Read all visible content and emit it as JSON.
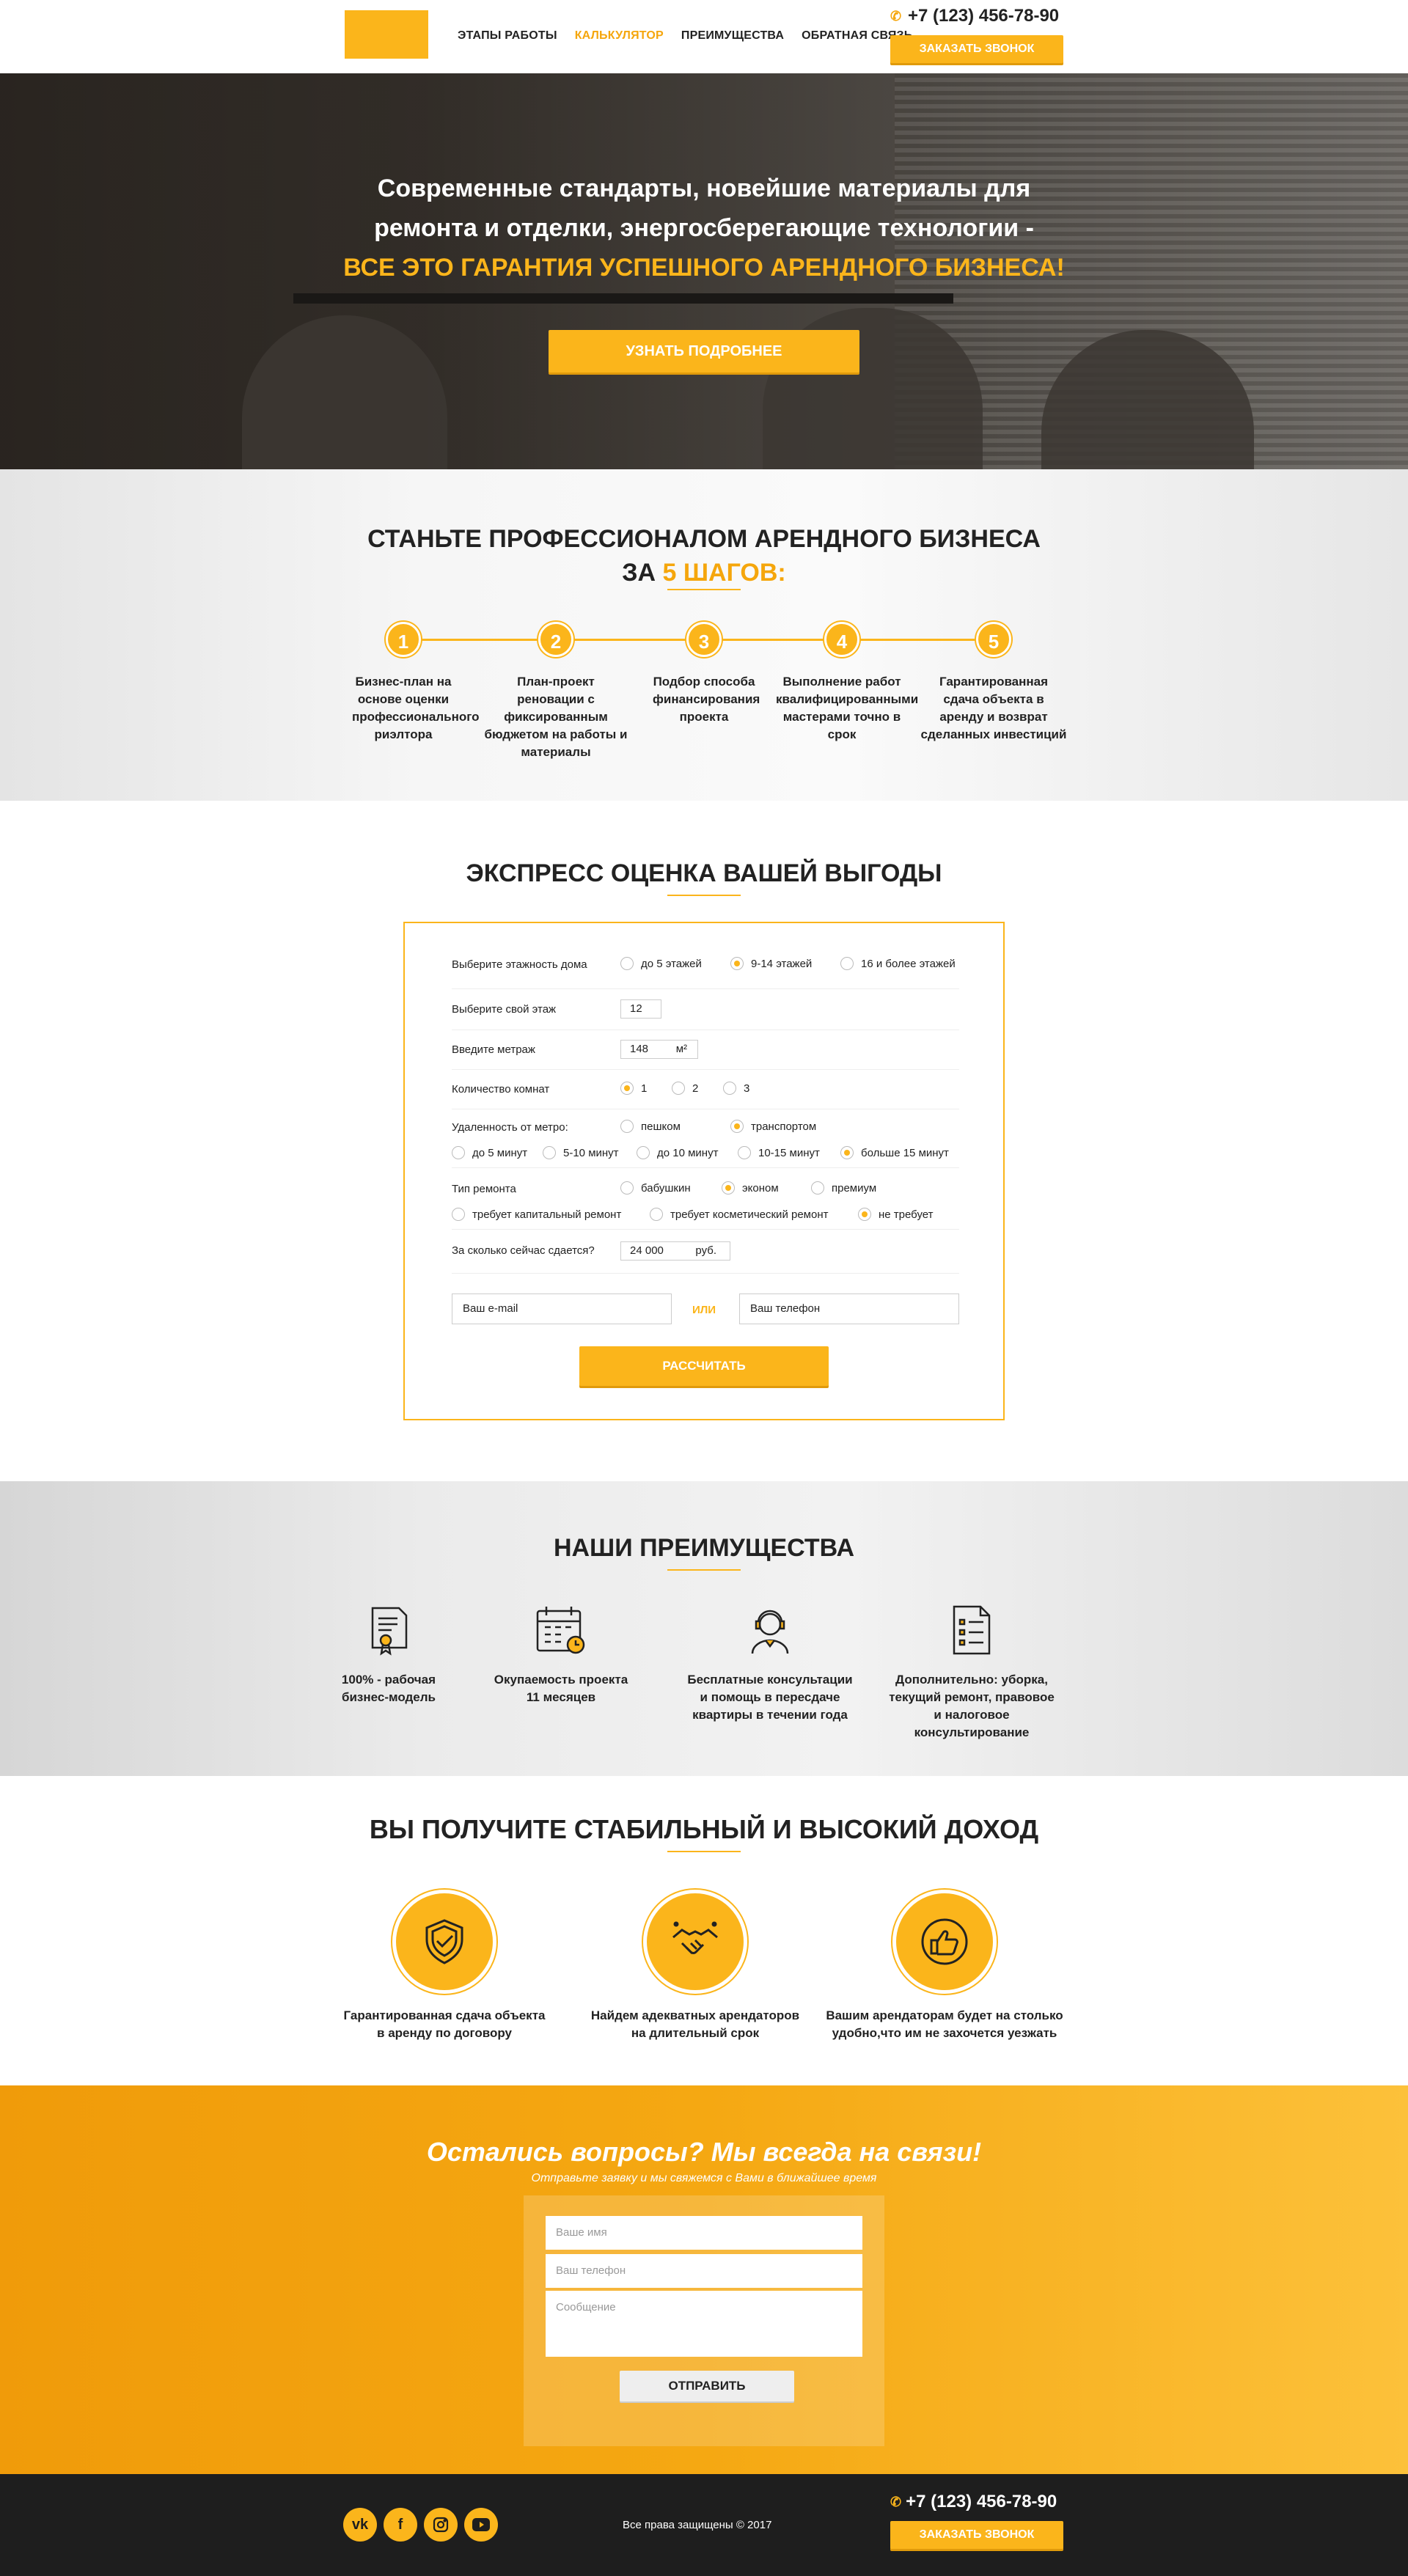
{
  "header": {
    "nav": [
      "ЭТАПЫ РАБОТЫ",
      "КАЛЬКУЛЯТОР",
      "ПРЕИМУЩЕСТВА",
      "ОБРАТНАЯ СВЯЗЬ"
    ],
    "active_nav_index": 1,
    "phone": "+7 (123) 456-78-90",
    "call_button": "ЗАКАЗАТЬ ЗВОНОК"
  },
  "hero": {
    "line1": "Современные стандарты, новейшие материалы для",
    "line2": "ремонта и отделки, энергосберегающие технологии -",
    "line3": "ВСЕ ЭТО ГАРАНТИЯ УСПЕШНОГО АРЕНДНОГО БИЗНЕСА!",
    "button": "УЗНАТЬ ПОДРОБНЕЕ"
  },
  "steps": {
    "title_line1": "СТАНЬТЕ ПРОФЕССИОНАЛОМ АРЕНДНОГО БИЗНЕСА",
    "title_line2_a": "ЗА ",
    "title_line2_b": "5 ШАГОВ:",
    "items": [
      {
        "num": "1",
        "text": "Бизнес-план на основе оценки профессионального риэлтора"
      },
      {
        "num": "2",
        "text": "План-проект реновации с фиксированным бюджетом на работы и материалы"
      },
      {
        "num": "3",
        "text": "Подбор способа финансирования проекта"
      },
      {
        "num": "4",
        "text": "Выполнение работ квалифицированными мастерами точно в срок"
      },
      {
        "num": "5",
        "text": "Гарантированная сдача объекта в аренду и возврат сделанных инвестиций"
      }
    ]
  },
  "express": {
    "title": "ЭКСПРЕСС ОЦЕНКА ВАШЕЙ ВЫГОДЫ",
    "floors_label": "Выберите этажность дома",
    "floors_options": [
      "до 5 этажей",
      "9-14 этажей",
      "16 и более этажей"
    ],
    "floors_selected": 1,
    "floor_label": "Выберите свой этаж",
    "floor_value": "12",
    "area_label": "Введите метраж",
    "area_value": "148",
    "area_unit": "м²",
    "rooms_label": "Количество комнат",
    "rooms_options": [
      "1",
      "2",
      "3"
    ],
    "rooms_selected": 0,
    "metro_label": "Удаленность от метро:",
    "metro_mode_options": [
      "пешком",
      "транспортом"
    ],
    "metro_mode_selected": 1,
    "metro_time_options": [
      "до 5 минут",
      "5-10 минут",
      "до 10 минут",
      "10-15 минут",
      "больше 15 минут"
    ],
    "metro_time_selected": 4,
    "repair_label": "Тип ремонта",
    "repair_options": [
      "бабушкин",
      "эконом",
      "премиум"
    ],
    "repair_selected": 1,
    "repair_need_options": [
      "требует капитальный ремонт",
      "требует косметический ремонт",
      "не требует"
    ],
    "repair_need_selected": 2,
    "rent_label": "За сколько сейчас сдается?",
    "rent_value": "24 000",
    "rent_unit": "руб.",
    "email_placeholder": "Ваш e-mail",
    "or": "ИЛИ",
    "phone_placeholder": "Ваш телефон",
    "button": "РАССЧИТАТЬ"
  },
  "advantages": {
    "title": "НАШИ ПРЕИМУЩЕСТВА",
    "items": [
      {
        "icon": "certificate-icon",
        "line1": "100% - рабочая",
        "line2": "бизнес-модель",
        "line3": ""
      },
      {
        "icon": "calendar-icon",
        "line1": "Окупаемость проекта",
        "line2": "11 месяцев",
        "line3": ""
      },
      {
        "icon": "consultant-icon",
        "line1": "Бесплатные консультации",
        "line2": "и помощь в пересдаче",
        "line3": "квартиры в течении года"
      },
      {
        "icon": "checklist-icon",
        "line1": "Дополнительно: уборка,",
        "line2": "текущий ремонт, правовое",
        "line3": "и налоговое консультирование"
      }
    ]
  },
  "income": {
    "title": "ВЫ ПОЛУЧИТЕ СТАБИЛЬНЫЙ И ВЫСОКИЙ ДОХОД",
    "items": [
      {
        "icon": "shield-check-icon",
        "line1": "Гарантированная сдача объекта",
        "line2": "в аренду по договору"
      },
      {
        "icon": "handshake-icon",
        "line1": "Найдем адекватных арендаторов",
        "line2": "на длительный срок"
      },
      {
        "icon": "thumbs-up-icon",
        "line1": "Вашим арендаторам будет на столько",
        "line2": "удобно,что им не захочется уезжать"
      }
    ]
  },
  "contact": {
    "title": "Остались вопросы? Мы всегда на связи!",
    "subtitle": "Отправьте заявку и мы свяжемся с Вами в ближайшее время",
    "name_placeholder": "Ваше имя",
    "phone_placeholder": "Ваш телефон",
    "message_placeholder": "Сообщение",
    "button": "ОТПРАВИТЬ"
  },
  "footer": {
    "social": [
      "vk-icon",
      "facebook-icon",
      "instagram-icon",
      "youtube-icon"
    ],
    "copyright": "Все права защищены © 2017",
    "phone": "+7 (123) 456-78-90",
    "call_button": "ЗАКАЗАТЬ ЗВОНОК"
  },
  "colors": {
    "accent": "#fbb51b",
    "dark": "#1e1e1e"
  }
}
